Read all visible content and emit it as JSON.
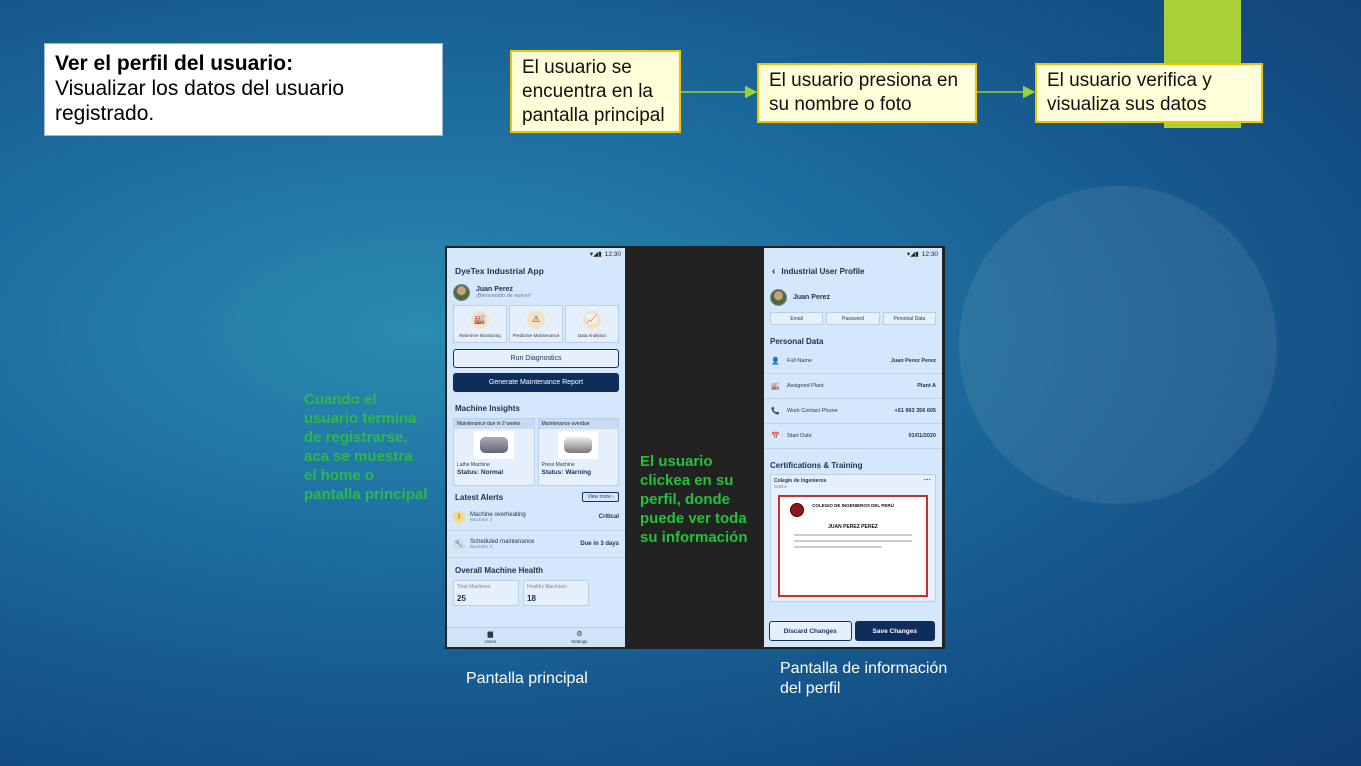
{
  "slide": {
    "title_bold": "Ver el perfil del usuario:",
    "title_text": "Visualizar los datos del usuario registrado.",
    "steps": [
      "El usuario se encuentra en la pantalla principal",
      "El usuario presiona en su nombre o foto",
      "El usuario verifica y visualiza sus datos"
    ],
    "left_note": "Cuando el usuario termina de registrarse, aca se muestra el home o pantalla principal",
    "middle_note": "El usuario clickea en su perfil, donde puede ver toda su información",
    "caption_left": "Pantalla principal",
    "caption_right": "Pantalla de información del perfil",
    "colors": {
      "accent_green": "#a9d13a",
      "step_border": "#f2c200",
      "red_arrow": "#e00000"
    }
  },
  "home": {
    "status_time": "12:30",
    "app_title": "DyeTex Industrial App",
    "user_name": "Juan Perez",
    "user_sub": "¡Bienvenido de nuevo!",
    "tiles": [
      {
        "label": "Real-time Monitoring",
        "icon": "factory-icon"
      },
      {
        "label": "Predictive Maintenance",
        "icon": "warning-icon"
      },
      {
        "label": "Data Analytics",
        "icon": "chart-icon"
      }
    ],
    "run_diagnostics": "Run Diagnostics",
    "generate_report": "Generate Maintenance Report",
    "insights_title": "Machine Insights",
    "cards": [
      {
        "head": "Maintenance due in 2 weeks",
        "name": "Lathe Machine",
        "status": "Status: Normal"
      },
      {
        "head": "Maintenance overdue",
        "name": "Press Machine",
        "status": "Status: Warning"
      }
    ],
    "alerts_title": "Latest Alerts",
    "view_more": "View more",
    "alerts": [
      {
        "title": "Machine overheating",
        "sub": "Machine 3",
        "right": "Critical"
      },
      {
        "title": "Scheduled maintenance",
        "sub": "Machine 4",
        "right": "Due in 3 days"
      }
    ],
    "health_title": "Overall Machine Health",
    "health": [
      {
        "label": "Total Machines",
        "value": "25"
      },
      {
        "label": "Healthy Machines",
        "value": "18"
      }
    ],
    "nav": [
      {
        "label": "Users"
      },
      {
        "label": "Settings"
      }
    ]
  },
  "profile": {
    "status_time": "12:30",
    "title": "Industrial User Profile",
    "user_name": "Juan Perez",
    "tabs": [
      "Email",
      "Password",
      "Personal Data"
    ],
    "personal_title": "Personal Data",
    "rows": [
      {
        "label": "Full Name",
        "value": "Juan Perez Perez"
      },
      {
        "label": "Assigned Plant",
        "value": "Plant A"
      },
      {
        "label": "Work Contact Phone",
        "value": "+51 963 356 605"
      },
      {
        "label": "Start Date",
        "value": "01/01/2020"
      }
    ],
    "cert_title": "Certifications & Training",
    "cert_org": "Colegio de Ingenieros",
    "cert_sub": "Online",
    "diploma_title": "COLEGIO DE INGENIEROS DEL PERÚ",
    "diploma_name": "JUAN PEREZ PEREZ",
    "discard": "Discard Changes",
    "save": "Save Changes"
  }
}
